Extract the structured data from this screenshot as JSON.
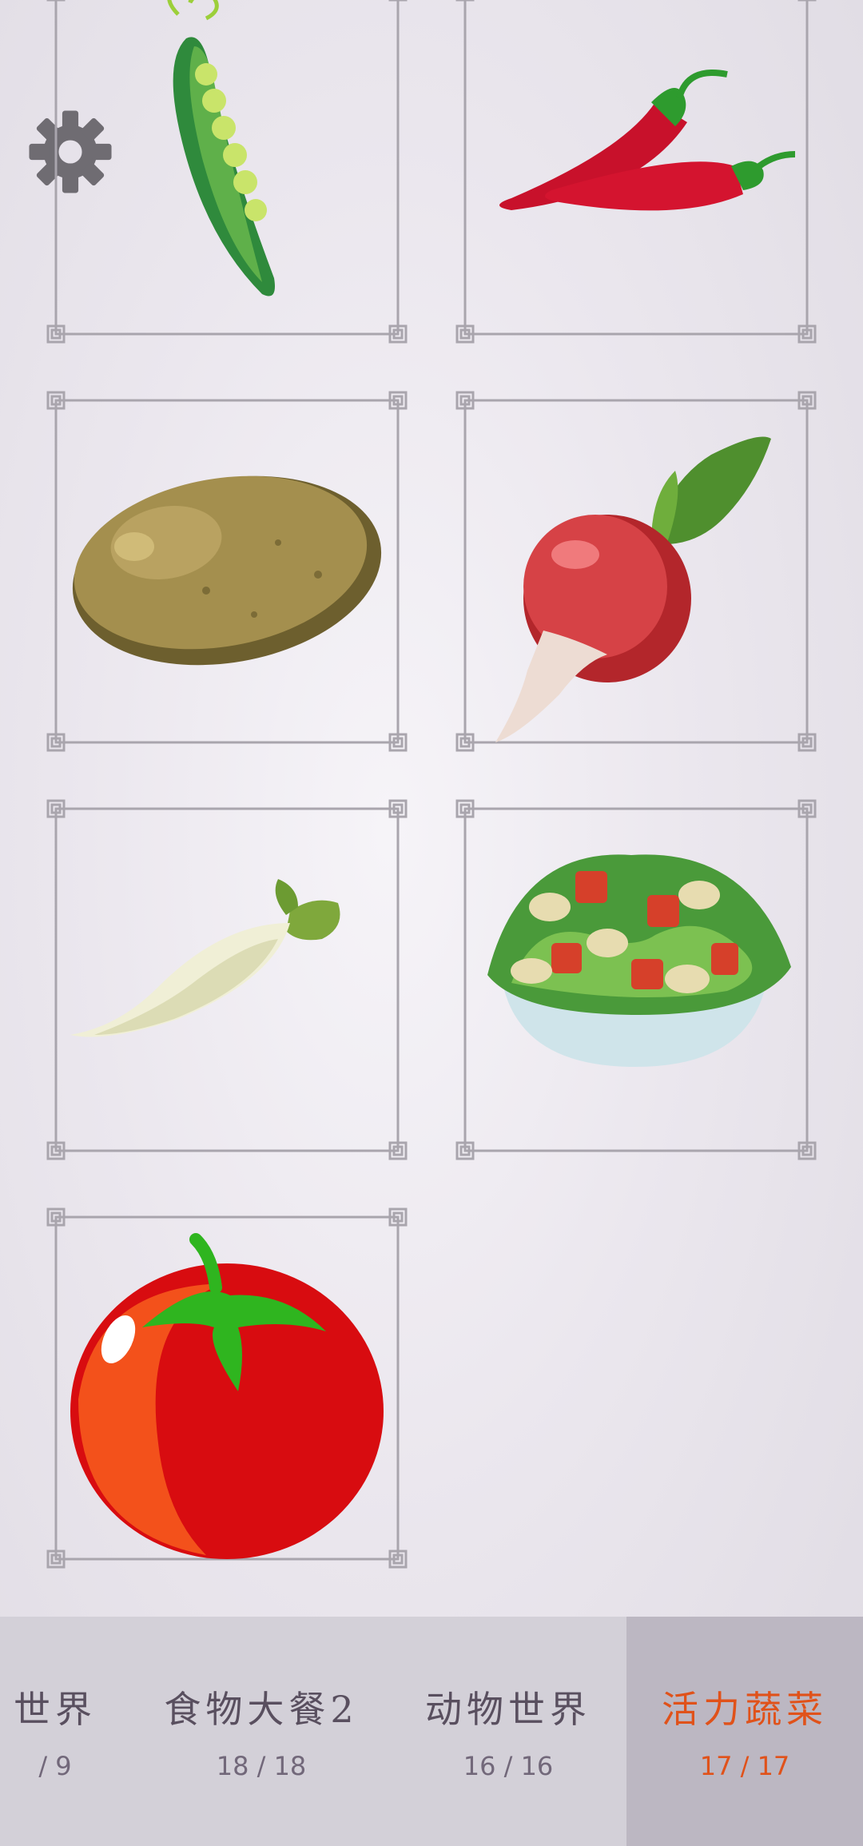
{
  "settings": {
    "icon": "gear-icon"
  },
  "cards": [
    {
      "item": "peas-icon"
    },
    {
      "item": "chili-peppers-icon"
    },
    {
      "item": "potato-icon"
    },
    {
      "item": "radish-icon"
    },
    {
      "item": "white-radish-icon"
    },
    {
      "item": "salad-bowl-icon"
    },
    {
      "item": "tomato-icon"
    }
  ],
  "tabs": [
    {
      "name": "世界",
      "count": "/ 9",
      "active": false
    },
    {
      "name": "食物大餐2",
      "count": "18 / 18",
      "active": false
    },
    {
      "name": "动物世界",
      "count": "16 / 16",
      "active": false
    },
    {
      "name": "活力蔬菜",
      "count": "17 / 17",
      "active": true
    }
  ],
  "colors": {
    "active_tab_text": "#e0521a",
    "active_tab_bg": "#bcb7c2",
    "tabbar_bg": "#d3d0d8",
    "frame": "#a9a5ad"
  }
}
